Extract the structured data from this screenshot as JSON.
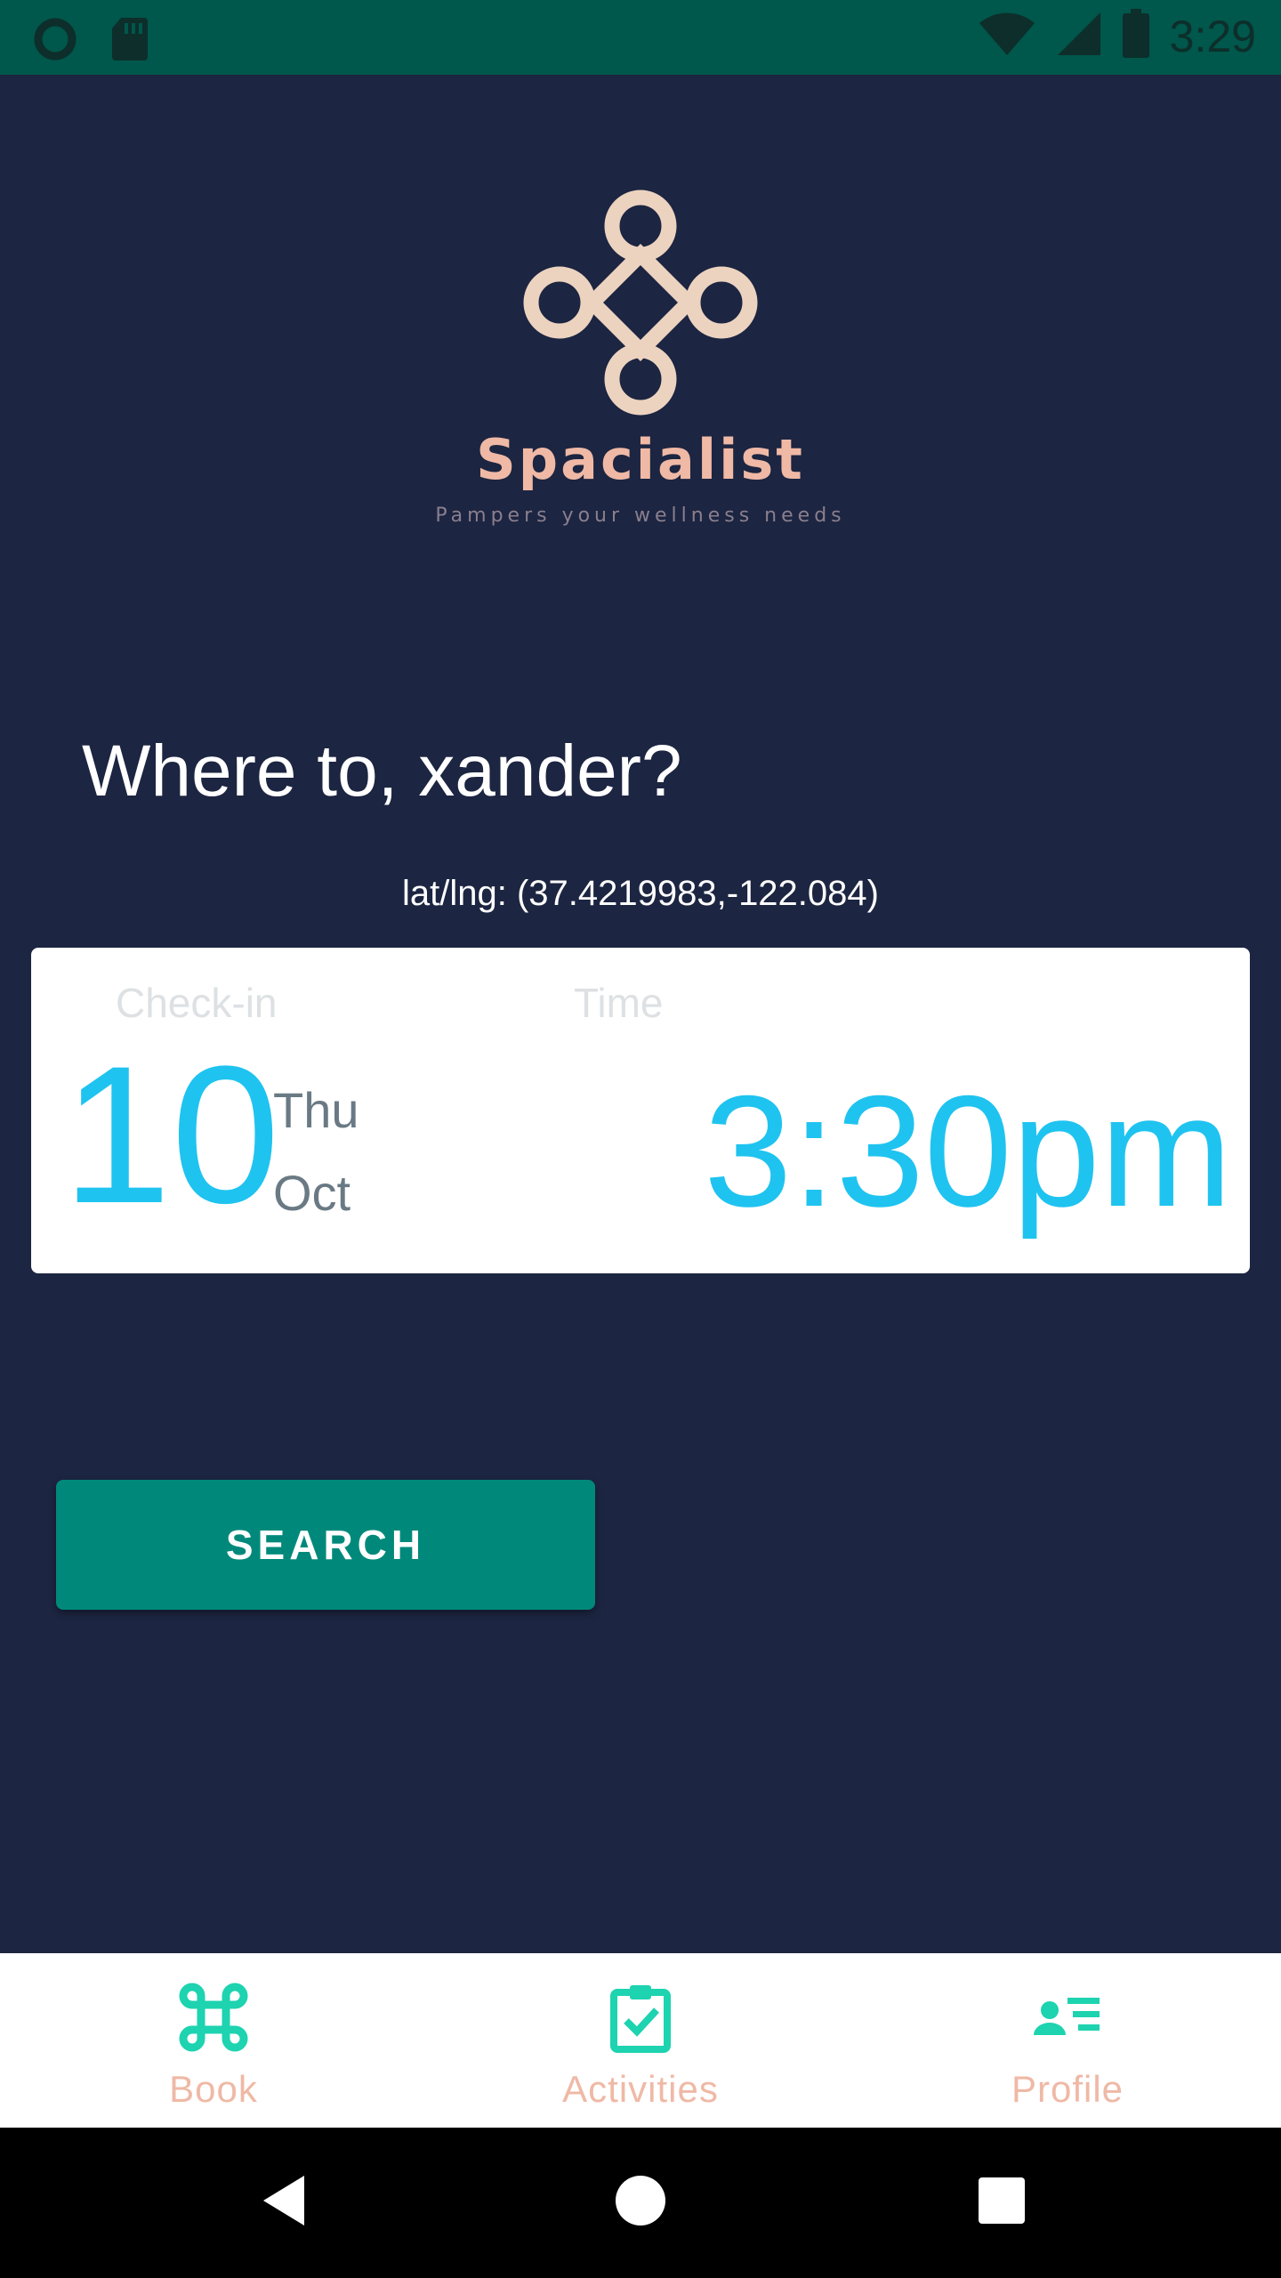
{
  "status_bar": {
    "time": "3:29",
    "icons": [
      "circle-notification-icon",
      "sd-card-icon",
      "wifi-icon",
      "cell-signal-icon",
      "battery-icon"
    ],
    "color": "#00574b"
  },
  "brand": {
    "name": "Spacialist",
    "tagline": "Pampers your wellness needs",
    "accent": "#efb9a6",
    "logo_icon": "knot-logo-icon"
  },
  "main": {
    "greeting": "Where to, xander?",
    "coordinates": "lat/lng: (37.4219983,-122.084)"
  },
  "booking_card": {
    "checkin_label": "Check-in",
    "time_label": "Time",
    "day": "10",
    "weekday": "Thu",
    "month": "Oct",
    "time": "3:30pm",
    "value_color": "#1fc3f0"
  },
  "search_button": {
    "label": "SEARCH",
    "color": "#00897b"
  },
  "bottom_nav": {
    "items": [
      {
        "label": "Book",
        "icon": "command-icon"
      },
      {
        "label": "Activities",
        "icon": "clipboard-check-icon"
      },
      {
        "label": "Profile",
        "icon": "profile-list-icon"
      }
    ],
    "icon_color": "#1dd3b0",
    "label_color": "#efb9a6"
  },
  "system_nav": {
    "icons": [
      "back-icon",
      "home-icon",
      "recents-icon"
    ]
  },
  "colors": {
    "background": "#1c2541"
  }
}
